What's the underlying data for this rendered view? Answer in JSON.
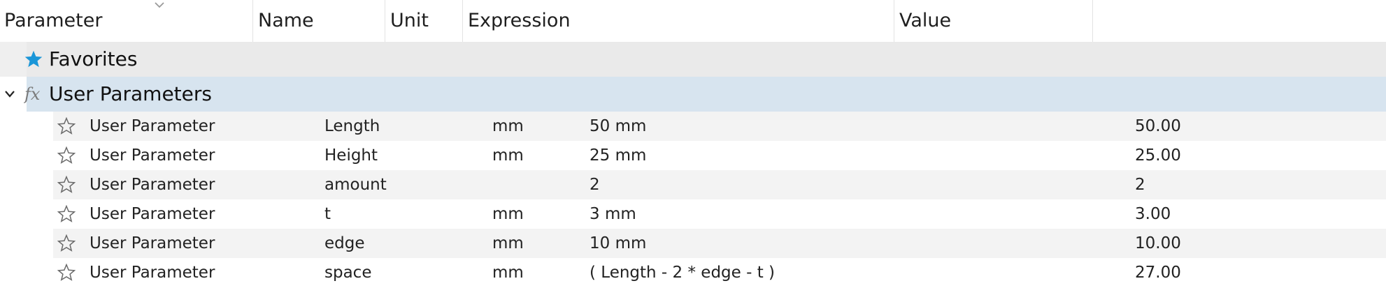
{
  "header": {
    "columns": [
      "Parameter",
      "Name",
      "Unit",
      "Expression",
      "Value"
    ]
  },
  "groups": {
    "favorites": {
      "label": "Favorites",
      "icon": "star-filled-icon"
    },
    "user_parameters": {
      "label": "User Parameters",
      "icon": "fx-icon",
      "expanded": true
    }
  },
  "rows": [
    {
      "parameter": "User Parameter",
      "name": "Length",
      "unit": "mm",
      "expression": "50 mm",
      "value": "50.00"
    },
    {
      "parameter": "User Parameter",
      "name": "Height",
      "unit": "mm",
      "expression": "25 mm",
      "value": "25.00"
    },
    {
      "parameter": "User Parameter",
      "name": "amount",
      "unit": "",
      "expression": "2",
      "value": "2"
    },
    {
      "parameter": "User Parameter",
      "name": "t",
      "unit": "mm",
      "expression": "3 mm",
      "value": "3.00"
    },
    {
      "parameter": "User Parameter",
      "name": "edge",
      "unit": "mm",
      "expression": "10 mm",
      "value": "10.00"
    },
    {
      "parameter": "User Parameter",
      "name": "space",
      "unit": "mm",
      "expression": "( Length - 2 * edge - t )",
      "value": "27.00"
    }
  ],
  "colors": {
    "favorite_star": "#1a96d8",
    "group_selected": "#d7e4ef",
    "row_alt": "#f3f3f3"
  }
}
